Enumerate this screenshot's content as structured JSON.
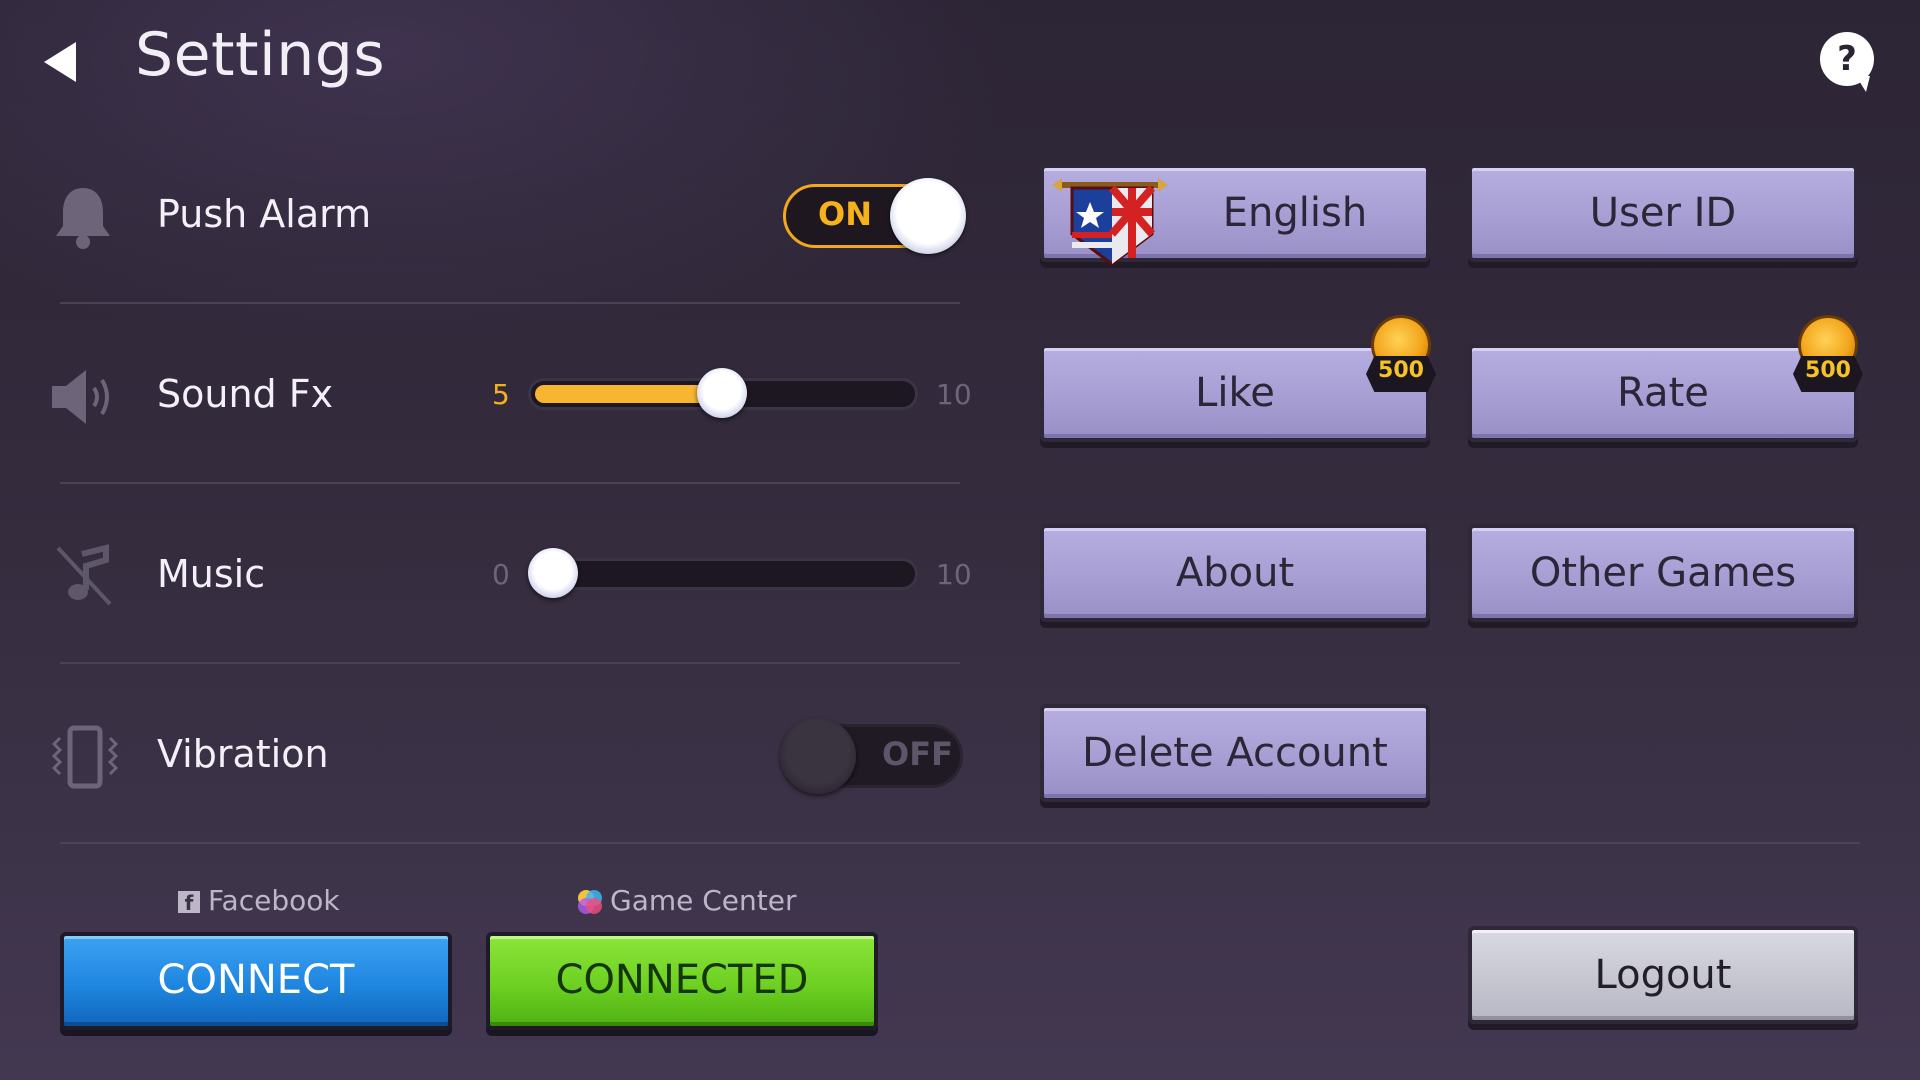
{
  "header": {
    "title": "Settings",
    "help_glyph": "?"
  },
  "rows": {
    "push_alarm": {
      "label": "Push Alarm",
      "state": "ON",
      "icon": "bell-icon"
    },
    "sound_fx": {
      "label": "Sound Fx",
      "min": "5",
      "max": "10",
      "value": 5,
      "range": [
        0,
        10
      ],
      "icon": "speaker-icon"
    },
    "music": {
      "label": "Music",
      "min": "0",
      "max": "10",
      "value": 0,
      "range": [
        0,
        10
      ],
      "icon": "music-muted-icon"
    },
    "vibration": {
      "label": "Vibration",
      "state": "OFF",
      "icon": "vibration-icon"
    }
  },
  "buttons": {
    "english": "English",
    "user_id": "User ID",
    "like": "Like",
    "rate": "Rate",
    "about": "About",
    "other_games": "Other Games",
    "delete_account": "Delete Account",
    "logout": "Logout"
  },
  "rewards": {
    "like": "500",
    "rate": "500"
  },
  "connections": {
    "facebook": {
      "label": "Facebook",
      "button": "CONNECT"
    },
    "game_center": {
      "label": "Game Center",
      "button": "CONNECTED"
    }
  },
  "colors": {
    "accent": "#f6b21a",
    "button_purple": "#a79fd3",
    "facebook_blue": "#1f86e0",
    "connected_green": "#6dd022"
  }
}
